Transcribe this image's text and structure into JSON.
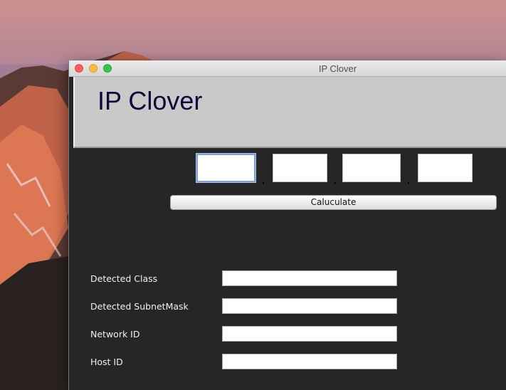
{
  "window": {
    "title": "IP Clover"
  },
  "header": {
    "app_title": "IP Clover"
  },
  "ip_input": {
    "octets": [
      "",
      "",
      "",
      ""
    ],
    "separator": "."
  },
  "toolbar": {
    "calculate_label": "Caluculate"
  },
  "results": {
    "fields": [
      {
        "label": "Detected Class",
        "value": ""
      },
      {
        "label": "Detected SubnetMask",
        "value": ""
      },
      {
        "label": "Network ID",
        "value": ""
      },
      {
        "label": "Host ID",
        "value": ""
      }
    ]
  },
  "colors": {
    "window_background": "#262626",
    "header_background": "#c9c9c9",
    "heading_text": "#0d0a3a",
    "focus_ring": "#7aa0d4"
  }
}
